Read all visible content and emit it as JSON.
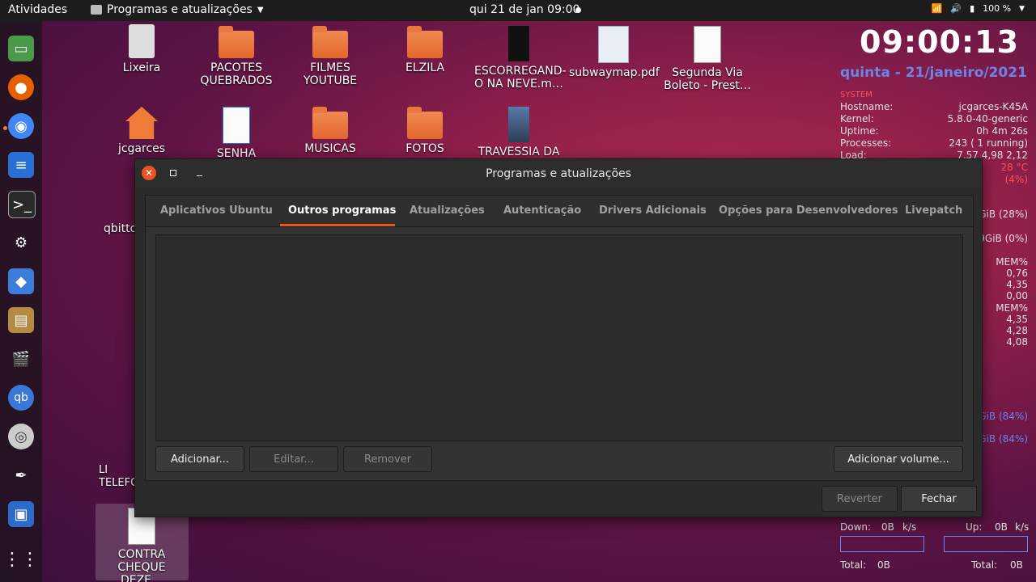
{
  "topbar": {
    "activities": "Atividades",
    "app_name": "Programas e atualizações",
    "clock": "qui 21 de jan  09:00",
    "battery": "100 %"
  },
  "desktop_icons": [
    {
      "label": "Lixeira"
    },
    {
      "label": "PACOTES QUEBRADOS"
    },
    {
      "label": "FILMES YOUTUBE"
    },
    {
      "label": "ELZILA"
    },
    {
      "label": "ESCORREGAND-O NA NEVE.m…"
    },
    {
      "label": "subwaymap.pdf"
    },
    {
      "label": "Segunda Via Boleto - Prest…"
    },
    {
      "label": "jcgarces"
    },
    {
      "label": "SENHA"
    },
    {
      "label": "MUSICAS"
    },
    {
      "label": "FOTOS"
    },
    {
      "label": "TRAVESSIA DA"
    },
    {
      "label": "qbitto"
    },
    {
      "label": "LI TELEFO"
    },
    {
      "label": "CONTRA CHEQUE DEZE…"
    }
  ],
  "conky": {
    "time": "09:00:13",
    "date": "quinta - 21/janeiro/2021",
    "system_header": "SYSTEM",
    "hostname_label": "Hostname:",
    "hostname": "jcgarces-K45A",
    "kernel_label": "Kernel:",
    "kernel": "5.8.0-40-generic",
    "uptime_label": "Uptime:",
    "uptime": "0h 4m 26s",
    "processes_label": "Processes:",
    "processes": "243 (   1 running)",
    "load_label": "Load:",
    "load": "7,57 4,98 2,12",
    "temp": "28 °C",
    "cpu": "(4%)",
    "mem1": "GiB (28%)",
    "swap": "9GiB (0%)",
    "mem_header": "MEM%",
    "mem_vals1": [
      "0,76",
      "4,35",
      "0,00"
    ],
    "mem_vals2": [
      "4,35",
      "4,28",
      "4,08"
    ],
    "pct": "0%%",
    "disk1": "GiB (84%)",
    "disk2": "GiB (84%)",
    "down_label": "Down:",
    "down_val": "0B",
    "down_unit": "k/s",
    "up_label": "Up:",
    "up_val": "0B",
    "up_unit": "k/s",
    "total_label": "Total:",
    "total_down": "0B",
    "total_up": "0B"
  },
  "window": {
    "title": "Programas e atualizações",
    "tabs": [
      "Aplicativos Ubuntu",
      "Outros programas",
      "Atualizações",
      "Autenticação",
      "Drivers Adicionais",
      "Opções para Desenvolvedores",
      "Livepatch"
    ],
    "active_tab": "Outros programas",
    "buttons": {
      "add": "Adicionar...",
      "edit": "Editar...",
      "remove": "Remover",
      "add_volume": "Adicionar volume...",
      "revert": "Reverter",
      "close": "Fechar"
    }
  },
  "colors": {
    "accent": "#e95420",
    "conky_blue": "#6a84e8",
    "conky_red": "#ff5050"
  }
}
